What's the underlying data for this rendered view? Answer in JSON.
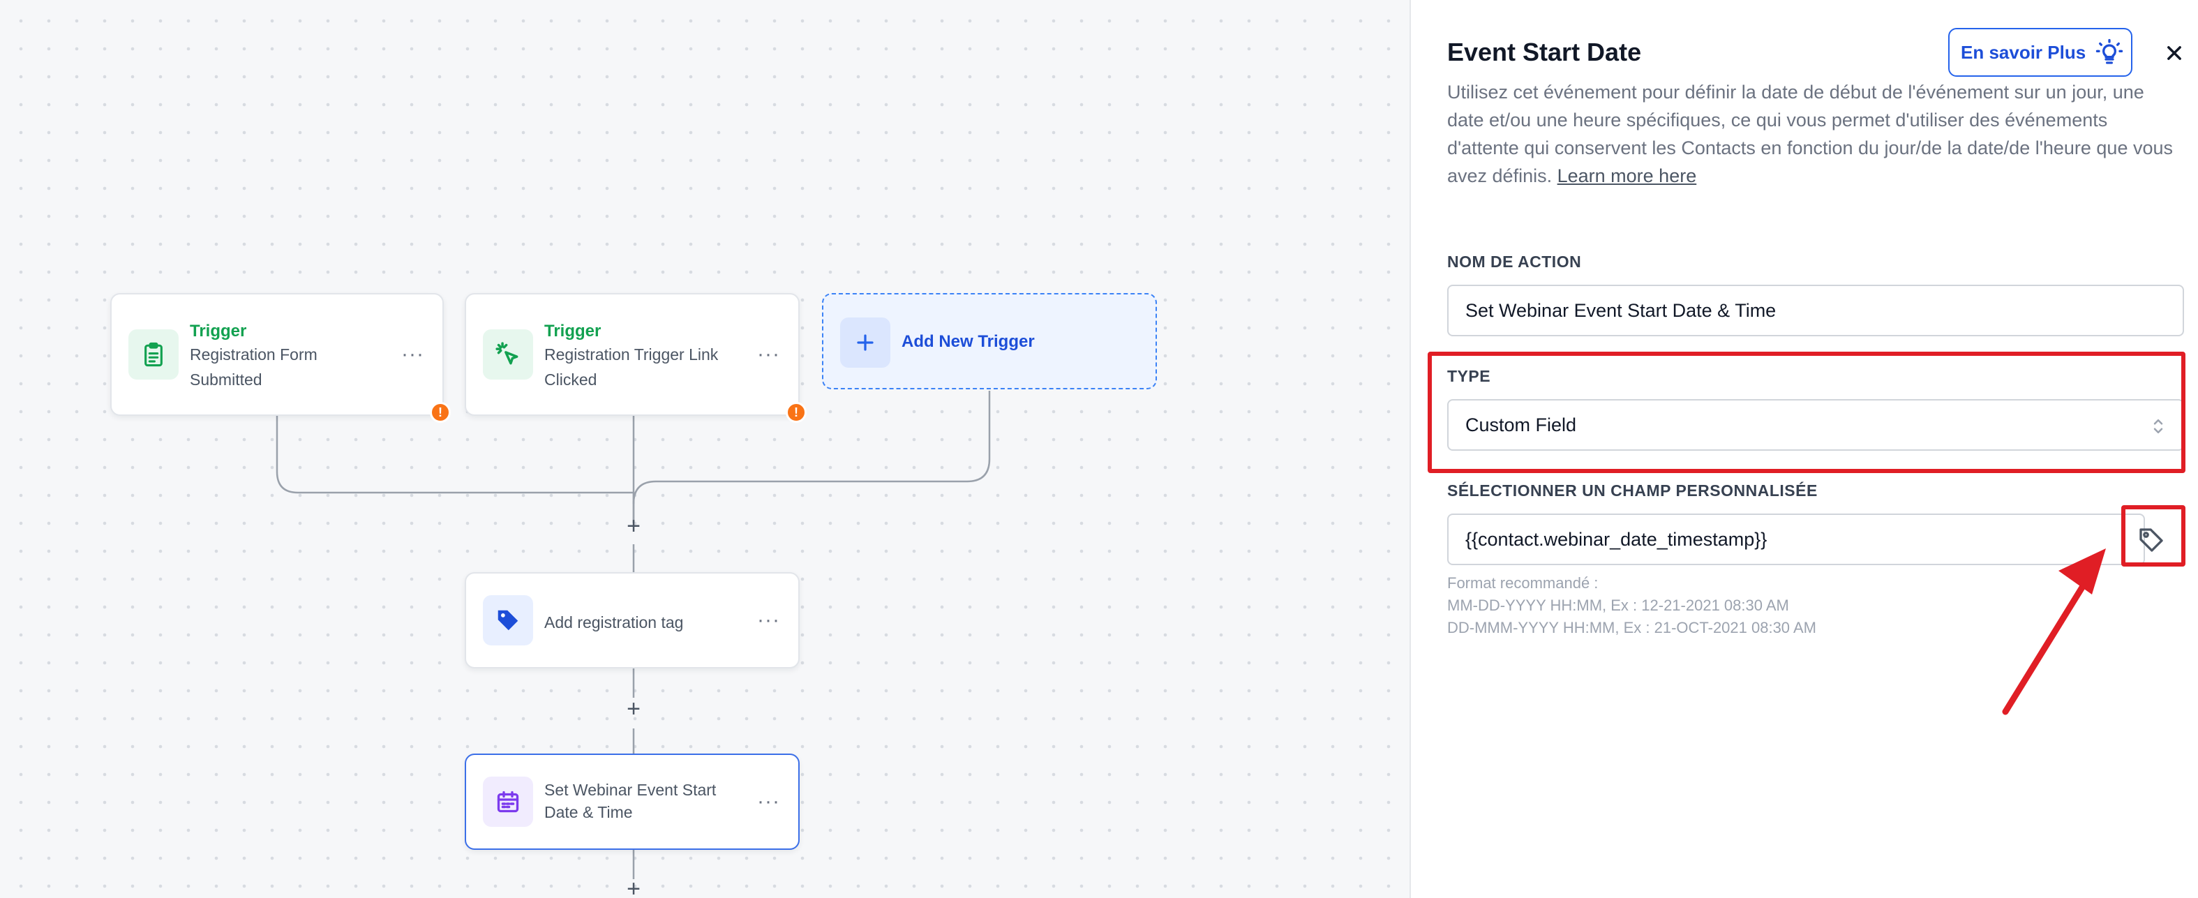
{
  "workflow": {
    "triggers": [
      {
        "kind": "Trigger",
        "title": "Registration Form Submitted"
      },
      {
        "kind": "Trigger",
        "title": "Registration Trigger Link Clicked"
      }
    ],
    "add_trigger_label": "Add New Trigger",
    "actions": [
      {
        "title": "Add registration tag"
      },
      {
        "title": "Set Webinar Event Start Date & Time"
      }
    ],
    "more_label": "···",
    "warning_symbol": "!",
    "plus_symbol": "+"
  },
  "panel": {
    "title": "Event Start Date",
    "learn_button": "En savoir Plus",
    "description": "Utilisez cet événement pour définir la date de début de l'événement sur un jour, une date et/ou une heure spécifiques, ce qui vous permet d'utiliser des événements d'attente qui conservent les Contacts en fonction du jour/de la date/de l'heure que vous avez définis.",
    "learn_more_link": "Learn more here",
    "action_name_label": "NOM DE ACTION",
    "action_name_value": "Set Webinar Event Start Date & Time",
    "type_label": "TYPE",
    "type_value": "Custom Field",
    "custom_field_label": "SÉLECTIONNER UN CHAMP PERSONNALISÉE",
    "custom_field_value": "{{contact.webinar_date_timestamp}}",
    "hint_title": "Format recommandé :",
    "hint_line1": "MM-DD-YYYY HH:MM, Ex : 12-21-2021 08:30 AM",
    "hint_line2": "DD-MMM-YYYY HH:MM, Ex : 21-OCT-2021 08:30 AM"
  },
  "icons": {
    "trigger_form": "clipboard-icon",
    "trigger_link": "cursor-click-icon",
    "action_tag": "tag-icon",
    "action_date": "calendar-icon",
    "learn": "lightbulb-icon",
    "close": "close-icon",
    "select": "chevron-updown-icon",
    "field_picker": "tag-outline-icon"
  },
  "colors": {
    "trigger_green": "#12a150",
    "primary_blue": "#2563eb",
    "warning_orange": "#f97316",
    "annotation_red": "#e01e25",
    "date_purple": "#7c3aed"
  }
}
